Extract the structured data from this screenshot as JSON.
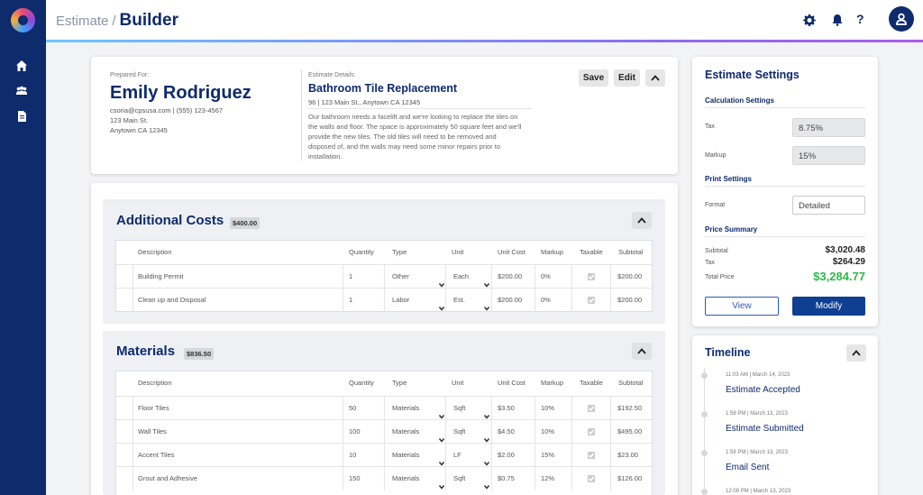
{
  "app": {
    "breadcrumb_parent": "Estimate",
    "breadcrumb_sep": "/",
    "page_title": "Builder",
    "help": "?"
  },
  "client": {
    "prepared_label": "Prepared For:",
    "name": "Emily Rodriguez",
    "contact": "csoria@cpsusa.com | (555) 123-4567",
    "street": "123 Main St.",
    "city": "Anytown CA 12345"
  },
  "estimate": {
    "details_label": "Estimate Details:",
    "title": "Bathroom Tile Replacement",
    "address": "96 | 123 Main St., Anytown CA 12345",
    "description_lines": [
      "Our bathroom needs a facelift and we're looking to replace the tiles on",
      "the walls and floor. The space is approximately 50 square feet and we'll",
      "provide the new tiles. The old tiles will need to be removed and",
      "disposed of, and the walls may need some minor repairs prior to",
      "installation."
    ],
    "save_label": "Save",
    "edit_label": "Edit"
  },
  "table_headers": {
    "description": "Description",
    "quantity": "Quantity",
    "type": "Type",
    "unit": "Unit",
    "unit_cost": "Unit Cost",
    "markup": "Markup",
    "taxable": "Taxable",
    "subtotal": "Subtotal"
  },
  "additional_costs": {
    "title": "Additional Costs",
    "total": "$400.00",
    "rows": [
      {
        "description": "Building Permit",
        "quantity": "1",
        "type": "Other",
        "unit": "Each",
        "unit_cost": "$200.00",
        "markup": "0%",
        "subtotal": "$200.00"
      },
      {
        "description": "Clean up and Disposal",
        "quantity": "1",
        "type": "Labor",
        "unit": "Est.",
        "unit_cost": "$200.00",
        "markup": "0%",
        "subtotal": "$200.00"
      }
    ]
  },
  "materials": {
    "title": "Materials",
    "total": "$836.50",
    "rows": [
      {
        "description": "Floor Tiles",
        "quantity": "50",
        "type": "Materials",
        "unit": "Sqft",
        "unit_cost": "$3.50",
        "markup": "10%",
        "subtotal": "$192.50"
      },
      {
        "description": "Wall Tiles",
        "quantity": "100",
        "type": "Materials",
        "unit": "Sqft",
        "unit_cost": "$4.50",
        "markup": "10%",
        "subtotal": "$495.00"
      },
      {
        "description": "Accent Tiles",
        "quantity": "10",
        "type": "Materials",
        "unit": "LF",
        "unit_cost": "$2.00",
        "markup": "15%",
        "subtotal": "$23.00"
      },
      {
        "description": "Grout and Adhesive",
        "quantity": "150",
        "type": "Materials",
        "unit": "Sqft",
        "unit_cost": "$0.75",
        "markup": "12%",
        "subtotal": "$126.00"
      }
    ]
  },
  "settings": {
    "title": "Estimate Settings",
    "calc_title": "Calculation Settings",
    "tax_label": "Tax",
    "tax_value": "8.75%",
    "markup_label": "Markup",
    "markup_value": "15%",
    "print_title": "Print Settings",
    "format_label": "Format",
    "format_value": "Detailed",
    "summary_title": "Price Summary",
    "subtotal_label": "Subtotal",
    "subtotal_value": "$3,020.48",
    "tax_sum_label": "Tax",
    "tax_sum_value": "$264.29",
    "total_label": "Total Price",
    "total_value": "$3,284.77",
    "view_label": "View",
    "modify_label": "Modify"
  },
  "timeline": {
    "title": "Timeline",
    "events": [
      {
        "time": "11:03 AM | March 14, 2023",
        "label": "Estimate Accepted"
      },
      {
        "time": "1:58 PM | March 13, 2023",
        "label": "Estimate Submitted"
      },
      {
        "time": "1:58 PM | March 13, 2023",
        "label": "Email Sent"
      },
      {
        "time": "12:09 PM | March 13, 2023",
        "label": ""
      }
    ]
  }
}
